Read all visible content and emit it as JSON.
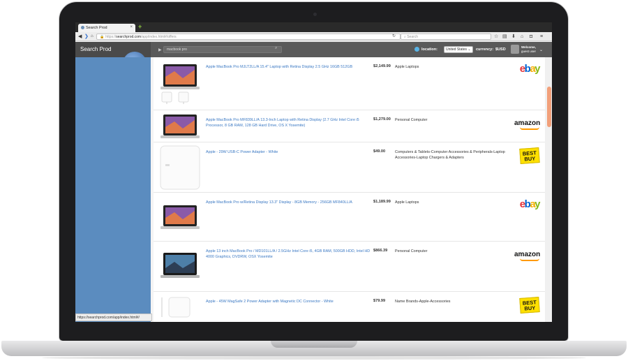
{
  "browser": {
    "tab_title": "Search Prod",
    "tab_close": "×",
    "new_tab": "+",
    "url_prefix": "https://",
    "url_domain": "searchprod.com",
    "url_path": "/app/index.html#/offers",
    "search_placeholder": "Search"
  },
  "app": {
    "brand": "Search Prod",
    "search_value": "macbook pro",
    "location_label": "location:",
    "location_value": "United States",
    "currency_label": "currency:",
    "currency_value": "$USD",
    "welcome_line1": "Welcome,",
    "welcome_line2": "guest user"
  },
  "status_bar": "https://searchprod.com/app/index.html#/",
  "icons": {
    "back": "back-arrow-icon",
    "forward": "forward-arrow-icon",
    "home": "home-icon",
    "reload": "reload-icon",
    "star": "star-icon",
    "library": "library-icon",
    "download": "download-icon",
    "pocket": "pocket-icon",
    "menu": "hamburger-menu-icon"
  },
  "colors": {
    "link": "#3a78c3",
    "sidebar": "#5b8cbf",
    "header": "#5a5a5a"
  },
  "results": [
    {
      "title": "Apple MacBook Pro MJLT2LL/A 15.4\" Laptop with Retina Display 2.5 GHz 16GB 512GB",
      "price": "$2,149.99",
      "category": "Apple Laptops",
      "store": "ebay",
      "image": "macbook-with-chargers"
    },
    {
      "title": "Apple MacBook Pro MF839LL/A 13.3-Inch Laptop with Retina Display (2.7 GHz Intel Core i5 Processor, 8 GB RAM, 128 GB Hard Drive, OS X Yosemite)",
      "price": "$1,279.00",
      "category": "Personal Computer",
      "store": "amazon",
      "image": "macbook"
    },
    {
      "title": "Apple - 29W USB-C Power Adapter - White",
      "price": "$49.00",
      "category": "Computers & Tablets-Computer Accessories & Peripherals-Laptop Accessories-Laptop Chargers & Adapters",
      "store": "bestbuy",
      "image": "power-adapter"
    },
    {
      "title": "Apple MacBook Pro w/Retina Display 13.3\" Display - 8GB Memory - 256GB MF840LL/A",
      "price": "$1,189.99",
      "category": "Apple Laptops",
      "store": "ebay",
      "image": "macbook"
    },
    {
      "title": "Apple 13 inch MacBook Pro / MD101LL/A / 2.5GHz Intel Core i5, 4GB RAM, 500GB HDD, Intel HD 4000 Graphics, DVDRW, OSX Yosemite",
      "price": "$866.39",
      "category": "Personal Computer",
      "store": "amazon",
      "image": "macbook-dark"
    },
    {
      "title": "Apple - 45W MagSafe 2 Power Adapter with Magnetic DC Connector - White",
      "price": "$79.99",
      "category": "Name Brands-Apple-Accessories",
      "store": "bestbuy",
      "image": "magsafe-adapter"
    }
  ],
  "store_logos": {
    "ebay": [
      "e",
      "b",
      "a",
      "y"
    ],
    "amazon": "amazon",
    "bestbuy_line1": "BEST",
    "bestbuy_line2": "BUY"
  }
}
